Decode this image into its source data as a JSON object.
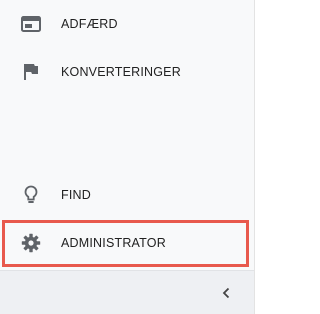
{
  "nav": {
    "items": [
      {
        "label": "ADFÆRD",
        "icon": "behavior-window-icon"
      },
      {
        "label": "KONVERTERINGER",
        "icon": "flag-icon"
      }
    ]
  },
  "bottom_nav": {
    "items": [
      {
        "label": "FIND",
        "icon": "lightbulb-icon"
      },
      {
        "label": "ADMINISTRATOR",
        "icon": "gear-icon"
      }
    ]
  },
  "footer": {
    "collapse_icon": "chevron-left-icon"
  },
  "colors": {
    "sidebar_bg": "#f8f9fa",
    "icon": "#5f6368",
    "text": "#212121",
    "highlight": "#e8594d",
    "footer_bg": "#eef0f3"
  }
}
